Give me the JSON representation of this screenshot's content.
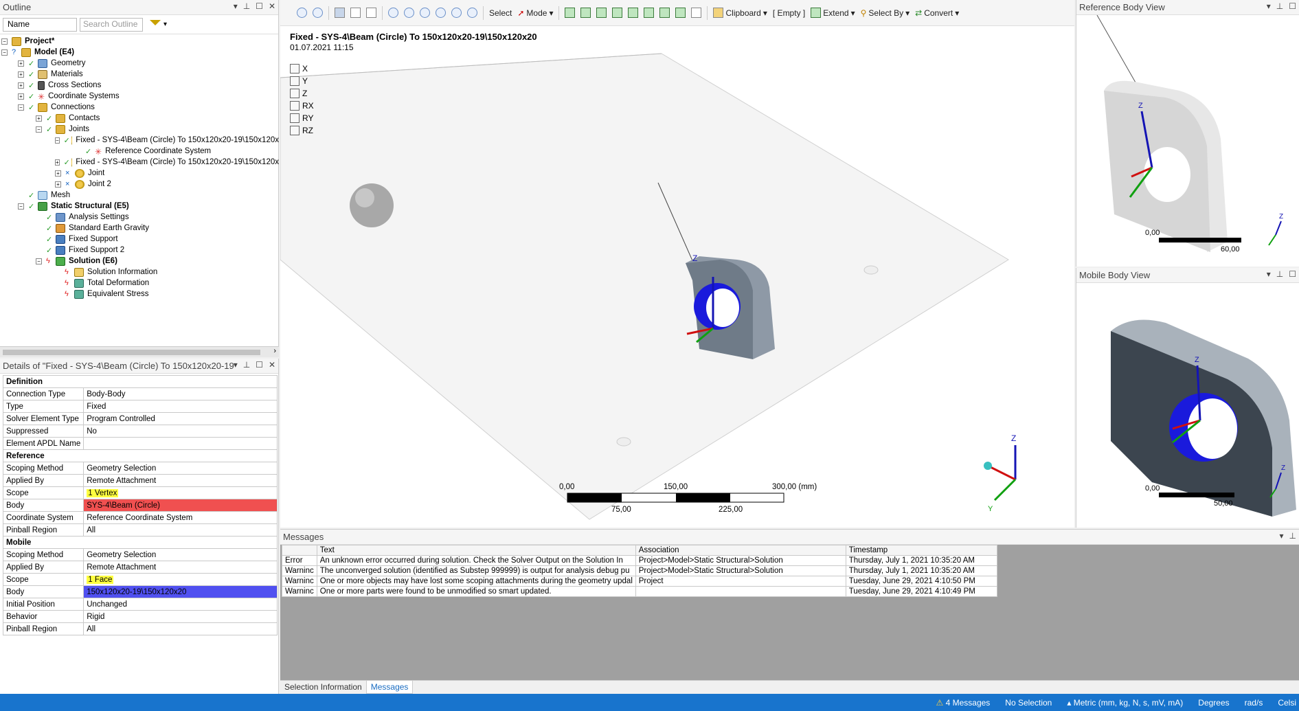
{
  "outline": {
    "title": "Outline",
    "filter_value": "Name",
    "search_placeholder": "Search Outline",
    "tree": [
      {
        "label": "Project*",
        "bold": true
      },
      {
        "label": "Model (E4)",
        "bold": true
      },
      {
        "label": "Geometry"
      },
      {
        "label": "Materials"
      },
      {
        "label": "Cross Sections"
      },
      {
        "label": "Coordinate Systems"
      },
      {
        "label": "Connections"
      },
      {
        "label": "Contacts"
      },
      {
        "label": "Joints"
      },
      {
        "label": "Fixed - SYS-4\\Beam (Circle) To 150x120x20-19\\150x120x"
      },
      {
        "label": "Reference Coordinate System"
      },
      {
        "label": "Fixed - SYS-4\\Beam (Circle) To 150x120x20-19\\150x120x"
      },
      {
        "label": "Joint"
      },
      {
        "label": "Joint 2"
      },
      {
        "label": "Mesh"
      },
      {
        "label": "Static Structural (E5)",
        "bold": true
      },
      {
        "label": "Analysis Settings"
      },
      {
        "label": "Standard Earth Gravity"
      },
      {
        "label": "Fixed Support"
      },
      {
        "label": "Fixed Support 2"
      },
      {
        "label": "Solution (E6)",
        "bold": true
      },
      {
        "label": "Solution Information"
      },
      {
        "label": "Total Deformation"
      },
      {
        "label": "Equivalent Stress"
      }
    ]
  },
  "details": {
    "title": "Details of \"Fixed - SYS-4\\Beam (Circle) To 150x120x20-19\\150x120",
    "sections": [
      {
        "name": "Definition",
        "rows": [
          [
            "Connection Type",
            "Body-Body"
          ],
          [
            "Type",
            "Fixed"
          ],
          [
            "Solver Element Type",
            "Program Controlled"
          ],
          [
            "Suppressed",
            "No"
          ],
          [
            "Element APDL Name",
            ""
          ]
        ]
      },
      {
        "name": "Reference",
        "rows": [
          [
            "Scoping Method",
            "Geometry Selection"
          ],
          [
            "Applied By",
            "Remote Attachment"
          ],
          [
            "Scope",
            "1 Vertex"
          ],
          [
            "Body",
            "SYS-4\\Beam (Circle)"
          ],
          [
            "Coordinate System",
            "Reference Coordinate System"
          ],
          [
            "Pinball Region",
            "All"
          ]
        ]
      },
      {
        "name": "Mobile",
        "rows": [
          [
            "Scoping Method",
            "Geometry Selection"
          ],
          [
            "Applied By",
            "Remote Attachment"
          ],
          [
            "Scope",
            "1 Face"
          ],
          [
            "Body",
            "150x120x20-19\\150x120x20"
          ],
          [
            "Initial Position",
            "Unchanged"
          ],
          [
            "Behavior",
            "Rigid"
          ],
          [
            "Pinball Region",
            "All"
          ]
        ]
      }
    ]
  },
  "toolbar": {
    "select": "Select",
    "mode": "Mode",
    "clipboard": "Clipboard",
    "empty": "[ Empty ]",
    "extend": "Extend",
    "select_by": "Select By",
    "convert": "Convert"
  },
  "viewport": {
    "title": "Fixed - SYS-4\\Beam (Circle) To 150x120x20-19\\150x120x20",
    "date": "01.07.2021 11:15",
    "dofs": [
      "X",
      "Y",
      "Z",
      "RX",
      "RY",
      "RZ"
    ],
    "scale_top": [
      "0,00",
      "150,00",
      "300,00 (mm)"
    ],
    "scale_bottom": [
      "75,00",
      "225,00"
    ],
    "axis_labels": {
      "z": "Z",
      "y": "Y"
    }
  },
  "ref_view": {
    "title": "Reference Body View",
    "scale_left": "0,00",
    "scale_right": "60,00"
  },
  "mob_view": {
    "title": "Mobile Body View",
    "scale_left": "0,00",
    "scale_right": "50,00"
  },
  "messages": {
    "title": "Messages",
    "headers": [
      "",
      "Text",
      "Association",
      "Timestamp"
    ],
    "rows": [
      [
        "Error",
        "An unknown error occurred during solution.  Check the Solver Output on the Solution In",
        "Project>Model>Static Structural>Solution",
        "Thursday, July 1, 2021 10:35:20 AM"
      ],
      [
        "Warninc",
        "The unconverged solution (identified as Substep 999999) is output for analysis debug pu",
        "Project>Model>Static Structural>Solution",
        "Thursday, July 1, 2021 10:35:20 AM"
      ],
      [
        "Warninc",
        "One or more objects may have lost some scoping attachments during the geometry updal",
        "Project",
        "Tuesday, June 29, 2021 4:10:50 PM"
      ],
      [
        "Warninc",
        "One or more parts were found to be unmodified so smart updated.",
        "",
        "Tuesday, June 29, 2021 4:10:49 PM"
      ]
    ]
  },
  "bottom_tabs": [
    "Selection Information",
    "Messages"
  ],
  "status": {
    "messages": "4 Messages",
    "selection": "No Selection",
    "units": "Metric (mm, kg, N, s, mV, mA)",
    "degrees": "Degrees",
    "rads": "rad/s",
    "celsius": "Celsi"
  }
}
